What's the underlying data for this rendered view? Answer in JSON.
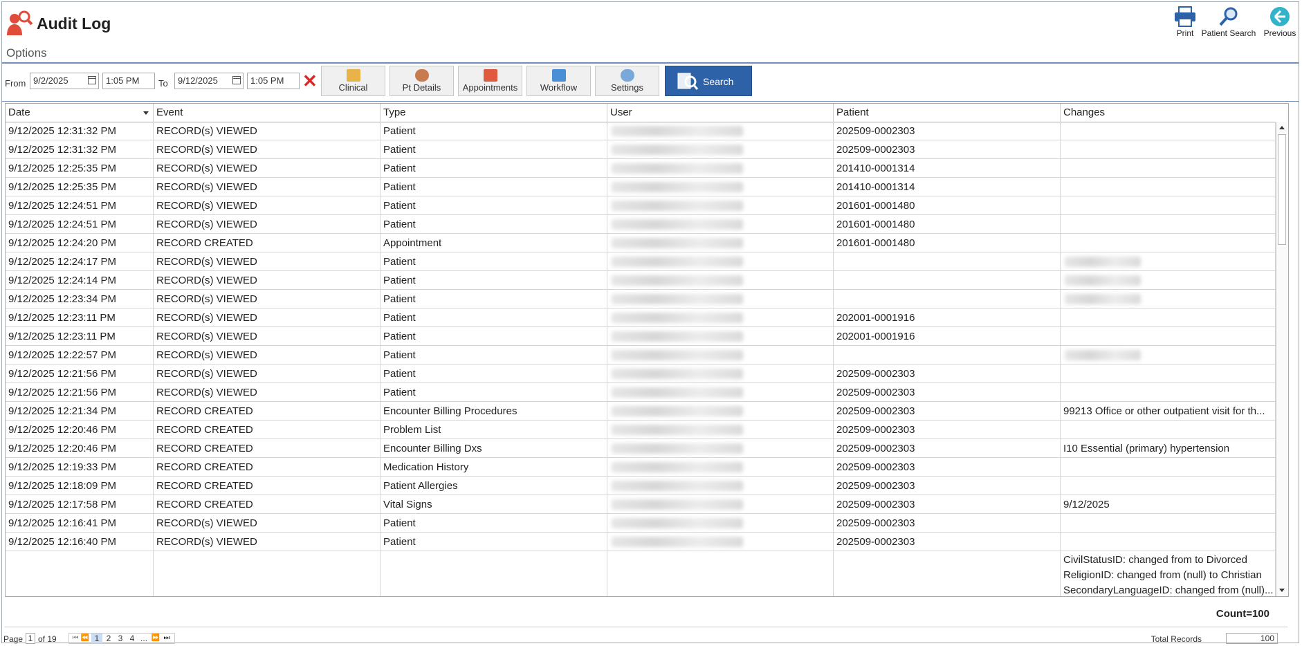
{
  "app": {
    "title": "Audit Log",
    "options_label": "Options"
  },
  "toolbar": {
    "print": "Print",
    "patient_search": "Patient Search",
    "previous": "Previous"
  },
  "filter": {
    "from_label": "From",
    "from_date": "9/2/2025",
    "from_time": "1:05 PM",
    "to_label": "To",
    "to_date": "9/12/2025",
    "to_time": "1:05 PM",
    "buttons": [
      "Clinical",
      "Pt Details",
      "Appointments",
      "Workflow",
      "Settings"
    ],
    "search_label": "Search"
  },
  "grid": {
    "columns": [
      "Date",
      "Event",
      "Type",
      "User",
      "Patient",
      "Changes"
    ],
    "rows": [
      [
        "9/12/2025 12:31:32 PM",
        "RECORD(s) VIEWED",
        "Patient",
        "",
        "202509-0002303",
        ""
      ],
      [
        "9/12/2025 12:31:32 PM",
        "RECORD(s) VIEWED",
        "Patient",
        "",
        "202509-0002303",
        ""
      ],
      [
        "9/12/2025 12:25:35 PM",
        "RECORD(s) VIEWED",
        "Patient",
        "",
        "201410-0001314",
        ""
      ],
      [
        "9/12/2025 12:25:35 PM",
        "RECORD(s) VIEWED",
        "Patient",
        "",
        "201410-0001314",
        ""
      ],
      [
        "9/12/2025 12:24:51 PM",
        "RECORD(s) VIEWED",
        "Patient",
        "",
        "201601-0001480",
        ""
      ],
      [
        "9/12/2025 12:24:51 PM",
        "RECORD(s) VIEWED",
        "Patient",
        "",
        "201601-0001480",
        ""
      ],
      [
        "9/12/2025 12:24:20 PM",
        "RECORD CREATED",
        "Appointment",
        "",
        "201601-0001480",
        ""
      ],
      [
        "9/12/2025 12:24:17 PM",
        "RECORD(s) VIEWED",
        "Patient",
        "",
        "",
        ""
      ],
      [
        "9/12/2025 12:24:14 PM",
        "RECORD(s) VIEWED",
        "Patient",
        "",
        "",
        ""
      ],
      [
        "9/12/2025 12:23:34 PM",
        "RECORD(s) VIEWED",
        "Patient",
        "",
        "",
        ""
      ],
      [
        "9/12/2025 12:23:11 PM",
        "RECORD(s) VIEWED",
        "Patient",
        "",
        "202001-0001916",
        ""
      ],
      [
        "9/12/2025 12:23:11 PM",
        "RECORD(s) VIEWED",
        "Patient",
        "",
        "202001-0001916",
        ""
      ],
      [
        "9/12/2025 12:22:57 PM",
        "RECORD(s) VIEWED",
        "Patient",
        "",
        "",
        ""
      ],
      [
        "9/12/2025 12:21:56 PM",
        "RECORD(s) VIEWED",
        "Patient",
        "",
        "202509-0002303",
        ""
      ],
      [
        "9/12/2025 12:21:56 PM",
        "RECORD(s) VIEWED",
        "Patient",
        "",
        "202509-0002303",
        ""
      ],
      [
        "9/12/2025 12:21:34 PM",
        "RECORD CREATED",
        "Encounter Billing Procedures",
        "",
        "202509-0002303",
        "99213 Office or other outpatient visit for th..."
      ],
      [
        "9/12/2025 12:20:46 PM",
        "RECORD CREATED",
        "Problem List",
        "",
        "202509-0002303",
        ""
      ],
      [
        "9/12/2025 12:20:46 PM",
        "RECORD CREATED",
        "Encounter Billing Dxs",
        "",
        "202509-0002303",
        "I10 Essential (primary) hypertension"
      ],
      [
        "9/12/2025 12:19:33 PM",
        "RECORD CREATED",
        "Medication History",
        "",
        "202509-0002303",
        ""
      ],
      [
        "9/12/2025 12:18:09 PM",
        "RECORD CREATED",
        "Patient Allergies",
        "",
        "202509-0002303",
        ""
      ],
      [
        "9/12/2025 12:17:58 PM",
        "RECORD CREATED",
        "Vital Signs",
        "",
        "202509-0002303",
        "9/12/2025"
      ],
      [
        "9/12/2025 12:16:41 PM",
        "RECORD(s) VIEWED",
        "Patient",
        "",
        "202509-0002303",
        ""
      ],
      [
        "9/12/2025 12:16:40 PM",
        "RECORD(s) VIEWED",
        "Patient",
        "",
        "202509-0002303",
        ""
      ]
    ],
    "last_row_changes": [
      "CivilStatusID: changed from  to Divorced",
      "ReligionID: changed from (null) to Christian",
      "SecondaryLanguageID: changed from (null)..."
    ],
    "count": "Count=100"
  },
  "pager": {
    "page_label": "Page",
    "page": "1",
    "of_label": "of 19",
    "pages": [
      "1",
      "2",
      "3",
      "4",
      "..."
    ],
    "total_label": "Total Records",
    "total_value": "100"
  }
}
